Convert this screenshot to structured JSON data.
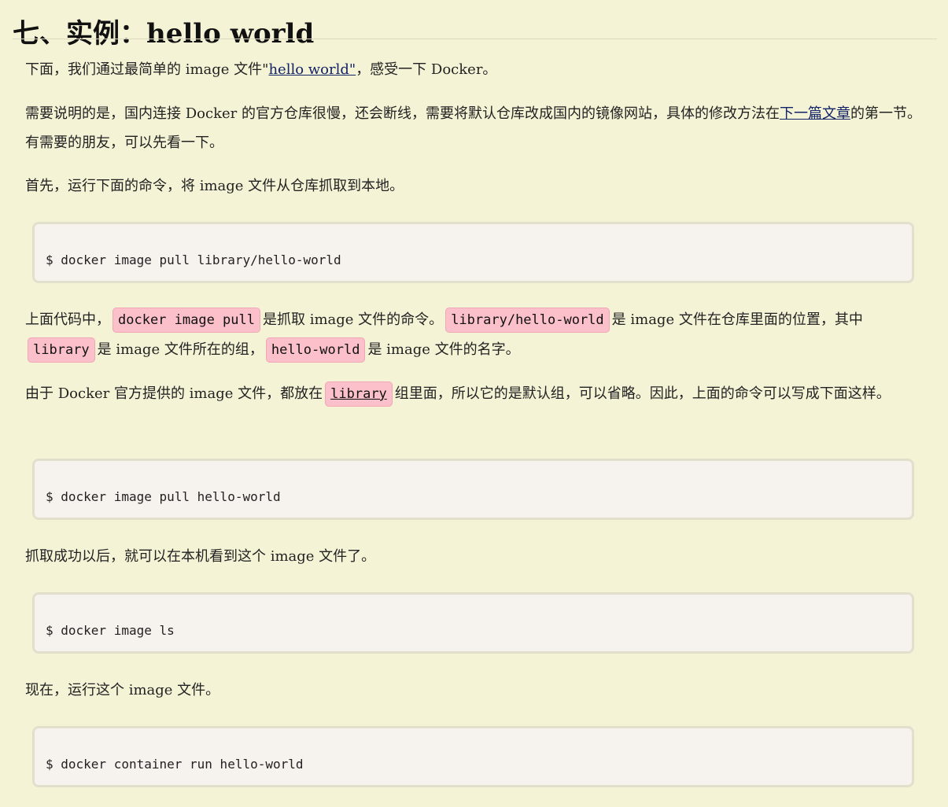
{
  "section_title": "七、实例：hello world",
  "p1": {
    "a": "下面，我们通过最简单的 image 文件\"",
    "link": "hello world\"",
    "b": "，感受一下 Docker。"
  },
  "p2": {
    "a": "需要说明的是，国内连接 Docker 的官方仓库很慢，还会断线，需要将默认仓库改成国内的镜像网站，具体的修改方法在",
    "link": "下一篇文章",
    "b": "的第一节。有需要的朋友，可以先看一下。"
  },
  "p3": "首先，运行下面的命令，将 image 文件从仓库抓取到本地。",
  "code1": "$ docker image pull library/hello-world",
  "p4": {
    "a": "上面代码中，",
    "code_a": "docker image pull",
    "b": "是抓取 image 文件的命令。",
    "code_b": "library/hello-world",
    "c": "是 image 文件在仓库里面的位置，其中",
    "code_c": "library",
    "d": "是 image 文件所在的组，",
    "code_d": "hello-world",
    "e": "是 image 文件的名字。"
  },
  "p5": {
    "a": "由于 Docker 官方提供的 image 文件，都放在",
    "code": "library",
    "b": "组里面，所以它的是默认组，可以省略。因此，上面的命令可以写成下面这样。"
  },
  "code2": "$ docker image pull hello-world",
  "p6": "抓取成功以后，就可以在本机看到这个 image 文件了。",
  "code3": "$ docker image ls",
  "p7": "现在，运行这个 image 文件。",
  "code4": "$ docker container run hello-world",
  "colors": {
    "background": "#f5f3d6",
    "inline_code_bg": "#fbc0ca",
    "code_block_bg": "#f6f2ee",
    "link": "#112266"
  }
}
